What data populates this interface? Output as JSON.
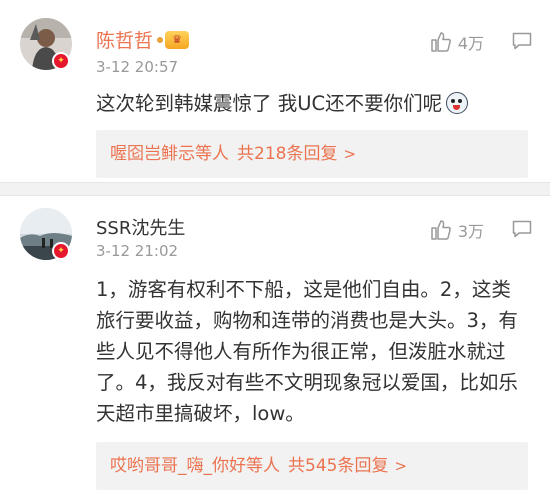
{
  "comments": [
    {
      "username": "陈哲哲",
      "timestamp": "3-12 20:57",
      "likes": "4万",
      "text": "这次轮到韩媒震惊了 我UC还不要你们呢",
      "reply_preview": {
        "users": "喔囵岂鲱忈",
        "suffix": "等人",
        "count": "共218条回复",
        "chevron": ">"
      }
    },
    {
      "username": "SSR沈先生",
      "timestamp": "3-12 21:02",
      "likes": "3万",
      "text": "1，游客有权利不下船，这是他们自由。2，这类旅行要收益，购物和连带的消费也是大头。3，有些人见不得他人有所作为很正常，但泼脏水就过了。4，我反对有些不文明现象冠以爱国，比如乐天超市里搞破坏，low。",
      "reply_preview": {
        "users": "哎哟哥哥_嗨_你好",
        "suffix": "等人",
        "count": "共545条回复",
        "chevron": ">"
      }
    }
  ],
  "colors": {
    "accent": "#eb7350",
    "muted": "#999999",
    "text": "#333333",
    "reply_bg": "#f2f2f2"
  },
  "icons": [
    "thumb-up-icon",
    "comment-icon",
    "verified-badge-icon",
    "vip-crown-icon",
    "emoji-icon"
  ]
}
